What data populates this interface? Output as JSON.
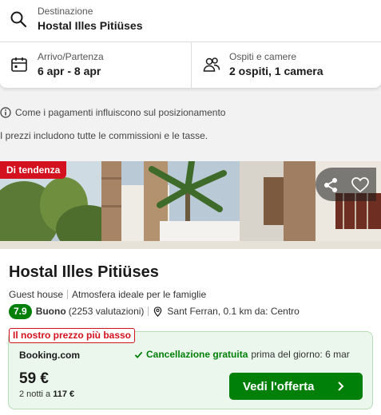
{
  "search": {
    "destination_label": "Destinazione",
    "destination_value": "Hostal Illes Pitiüses",
    "dates_label": "Arrivo/Partenza",
    "dates_value": "6 apr - 8 apr",
    "guests_label": "Ospiti e camere",
    "guests_value": "2 ospiti, 1 camera",
    "icons": [
      "search-icon",
      "calendar-icon",
      "people-icon"
    ]
  },
  "info": {
    "ranking_note": "Come i pagamenti influiscono sul posizionamento",
    "tax_note": "I prezzi includono tutte le commissioni e le tasse."
  },
  "hotel": {
    "badge": "Di tendenza",
    "name": "Hostal Illes Pitiüses",
    "type": "Guest house",
    "vibe": "Atmosfera ideale per le famiglie",
    "score": "7.9",
    "score_word": "Buono",
    "reviews": "(2253 valutazioni)",
    "location": "Sant Ferran, 0.1 km da: Centro",
    "colors": {
      "score_bg": "#008009",
      "badge_bg": "#d4111e"
    }
  },
  "offer": {
    "badge": "Il nostro prezzo più basso",
    "provider": "Booking.com",
    "cancel_free": "Cancellazione gratuita",
    "cancel_until": "prima del giorno: 6 mar",
    "price": "59 €",
    "nights_prefix": "2 notti a",
    "nights_total": "117 €",
    "button": "Vedi l'offerta",
    "colors": {
      "box_bg": "#ebf7ec",
      "button_bg": "#008009"
    }
  }
}
